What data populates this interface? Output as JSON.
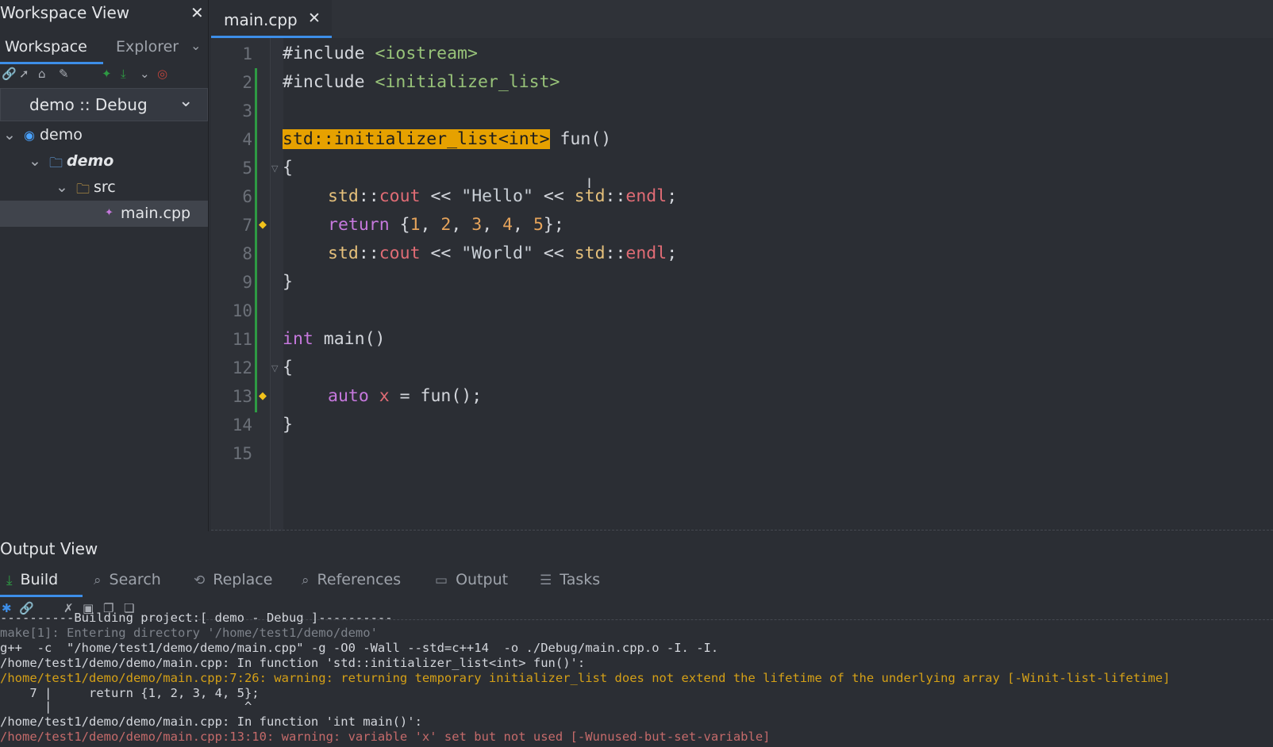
{
  "workspace": {
    "title": "Workspace View",
    "close": "✕",
    "tabs": [
      {
        "label": "Workspace"
      },
      {
        "label": "Explorer"
      }
    ],
    "config": "demo :: Debug",
    "tree": [
      {
        "label": "demo"
      },
      {
        "label": "demo"
      },
      {
        "label": "src"
      },
      {
        "label": "main.cpp"
      }
    ]
  },
  "editor": {
    "tab_label": "main.cpp",
    "tab_close": "✕",
    "line_numbers": [
      "1",
      "2",
      "3",
      "4",
      "5",
      "6",
      "7",
      "8",
      "9",
      "10",
      "11",
      "12",
      "13",
      "14",
      "15"
    ]
  },
  "code": {
    "l1a": "#include ",
    "l1b": "<iostream>",
    "l2a": "#include ",
    "l2b": "<initializer_list>",
    "l4a": "std::initializer_list<int>",
    "l4b": " fun()",
    "l5": "{",
    "l6a": "std",
    "l6b": "::",
    "l6c": "cout",
    "l6d": " << ",
    "l6e": "\"Hello\"",
    "l6f": " << ",
    "l6g": "std",
    "l6h": "::",
    "l6i": "endl",
    "l6j": ";",
    "l7a": "return",
    "l7b": " {",
    "l7c": "1",
    "l7d": ", ",
    "l7e": "2",
    "l7f": ", ",
    "l7g": "3",
    "l7h": ", ",
    "l7i": "4",
    "l7j": ", ",
    "l7k": "5",
    "l7l": "};",
    "l8a": "std",
    "l8b": "::",
    "l8c": "cout",
    "l8d": " << ",
    "l8e": "\"World\"",
    "l8f": " << ",
    "l8g": "std",
    "l8h": "::",
    "l8i": "endl",
    "l8j": ";",
    "l9": "}",
    "l11a": "int",
    "l11b": " main()",
    "l12": "{",
    "l13a": "auto",
    "l13b": " x",
    "l13c": " = fun();",
    "l14": "}"
  },
  "output": {
    "title": "Output View",
    "tabs": [
      {
        "label": "Build"
      },
      {
        "label": "Search"
      },
      {
        "label": "Replace"
      },
      {
        "label": "References"
      },
      {
        "label": "Output"
      },
      {
        "label": "Tasks"
      }
    ],
    "log": [
      "----------Building project:[ demo - Debug ]----------",
      "make[1]: Entering directory '/home/test1/demo/demo'",
      "g++  -c  \"/home/test1/demo/demo/main.cpp\" -g -O0 -Wall --std=c++14  -o ./Debug/main.cpp.o -I. -I.",
      "/home/test1/demo/demo/main.cpp: In function 'std::initializer_list<int> fun()':",
      "/home/test1/demo/demo/main.cpp:7:26: warning: returning temporary initializer_list does not extend the lifetime of the underlying array [-Winit-list-lifetime]",
      "    7 |     return {1, 2, 3, 4, 5};",
      "      |                          ^",
      "/home/test1/demo/demo/main.cpp: In function 'int main()':",
      "/home/test1/demo/demo/main.cpp:13:10: warning: variable 'x' set but not used [-Wunused-but-set-variable]"
    ]
  },
  "colors": {
    "accent": "#3d8ee8",
    "highlight": "#e6a100",
    "change_bar": "#2e9a43"
  }
}
